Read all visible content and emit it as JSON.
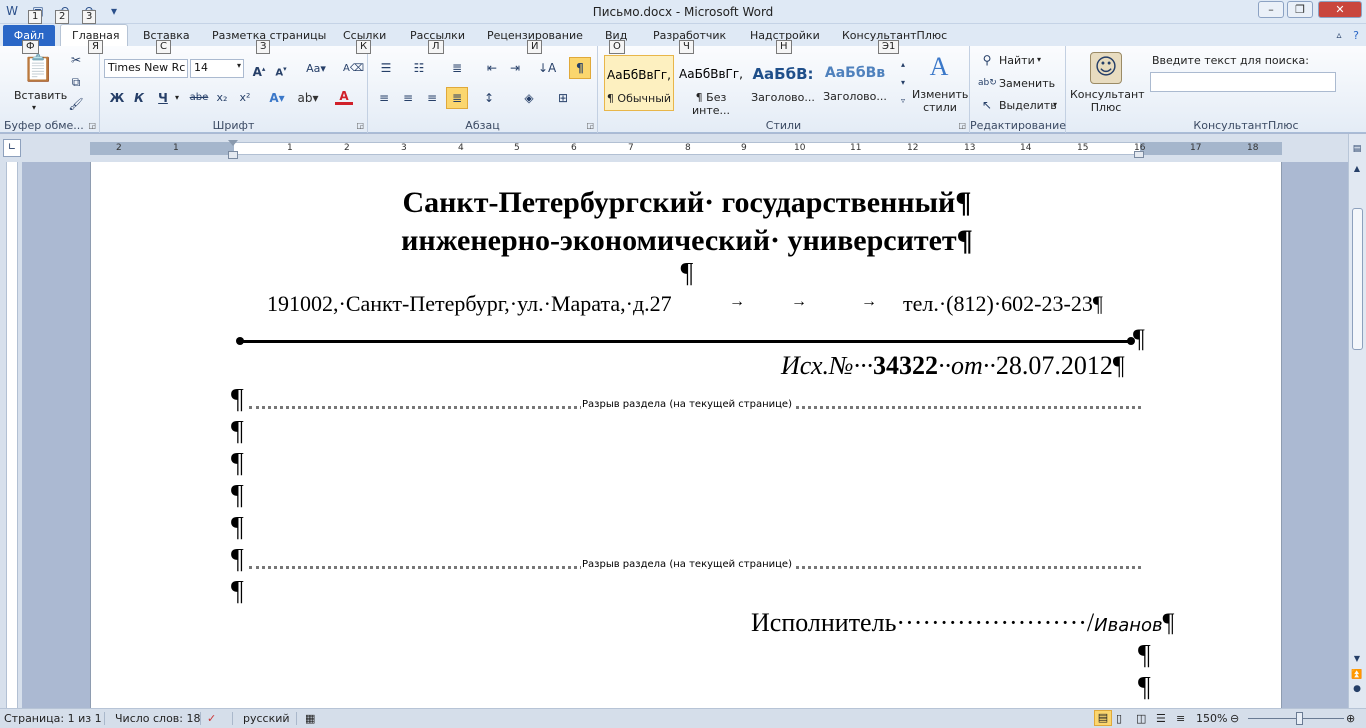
{
  "window": {
    "title": "Письмо.docx - Microsoft Word",
    "min": "–",
    "max": "❐",
    "close": "✕"
  },
  "qat": {
    "keytips": [
      "1",
      "2",
      "3"
    ]
  },
  "tabs": {
    "file": "Файл",
    "items": [
      "Главная",
      "Вставка",
      "Разметка страницы",
      "Ссылки",
      "Рассылки",
      "Рецензирование",
      "Вид",
      "Разработчик",
      "Надстройки",
      "КонсультантПлюс"
    ],
    "keytips": [
      "Ф",
      "Я",
      "С",
      "З",
      "К",
      "Л",
      "И",
      "О",
      "Ч",
      "Н",
      "Э1"
    ]
  },
  "ribbon": {
    "clipboard": {
      "label": "Буфер обме...",
      "paste": "Вставить"
    },
    "font": {
      "label": "Шрифт",
      "name": "Times New Rc",
      "size": "14",
      "bold": "Ж",
      "italic": "К",
      "underline": "Ч",
      "strike": "abe",
      "sub": "x₂",
      "sup": "x²"
    },
    "paragraph": {
      "label": "Абзац"
    },
    "styles": {
      "label": "Стили",
      "items": [
        {
          "preview": "АаБбВвГг,",
          "name": "¶ Обычный"
        },
        {
          "preview": "АаБбВвГг,",
          "name": "¶ Без инте..."
        },
        {
          "preview": "АаБбВ:",
          "name": "Заголово..."
        },
        {
          "preview": "АаБбВв",
          "name": "Заголово..."
        }
      ],
      "change": "Изменить стили"
    },
    "editing": {
      "label": "Редактирование",
      "find": "Найти",
      "replace": "Заменить",
      "select": "Выделить"
    },
    "consultant": {
      "button": "Консультант Плюс",
      "search_label": "Введите текст для поиска:",
      "label": "КонсультантПлюс"
    }
  },
  "ruler": {
    "numbers": [
      "2",
      "1",
      "1",
      "2",
      "3",
      "4",
      "5",
      "6",
      "7",
      "8",
      "9",
      "10",
      "11",
      "12",
      "13",
      "14",
      "15",
      "16",
      "17",
      "18"
    ]
  },
  "document": {
    "title_line1": "Санкт-Петербургский· государственный¶",
    "title_line2": "инженерно-экономический· университет¶",
    "empty_mark": "¶",
    "address": "191002,·Санкт-Петербург,·ул.·Марата,·д.27",
    "tab_arrow": "→",
    "phone": "тел.·(812)·602-23-23¶",
    "ref_prefix": "Исх.№···",
    "ref_number": "34322",
    "ref_mid": "··от··",
    "ref_date": "28.07.2012¶",
    "section_break": "Разрыв раздела (на текущей странице)",
    "executor_label": "Исполнитель······················/",
    "executor_name": "Иванов"
  },
  "status": {
    "page": "Страница: 1 из 1",
    "words": "Число слов: 18",
    "lang": "русский",
    "zoom": "150%"
  }
}
